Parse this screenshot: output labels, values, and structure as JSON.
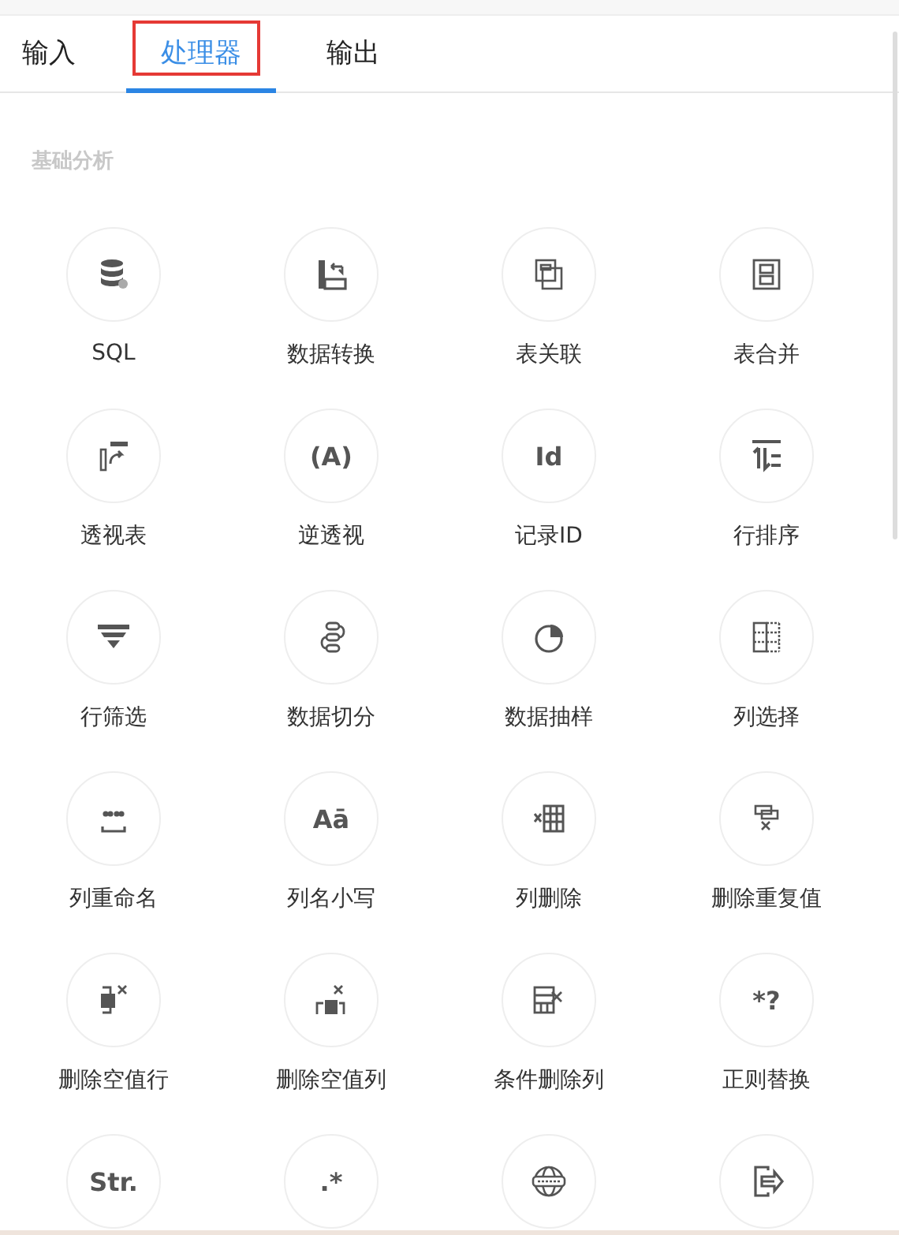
{
  "tabs": [
    {
      "label": "输入",
      "selected": false,
      "highlighted": false
    },
    {
      "label": "处理器",
      "selected": true,
      "highlighted": true
    },
    {
      "label": "输出",
      "selected": false,
      "highlighted": false
    }
  ],
  "section": {
    "title": "基础分析"
  },
  "tools": [
    {
      "label": "SQL",
      "kind": "icon"
    },
    {
      "label": "数据转换",
      "kind": "icon"
    },
    {
      "label": "表关联",
      "kind": "icon"
    },
    {
      "label": "表合并",
      "kind": "icon"
    },
    {
      "label": "透视表",
      "kind": "icon"
    },
    {
      "label": "逆透视",
      "kind": "glyph",
      "glyph": "(A)"
    },
    {
      "label": "记录ID",
      "kind": "glyph",
      "glyph": "Id"
    },
    {
      "label": "行排序",
      "kind": "icon"
    },
    {
      "label": "行筛选",
      "kind": "icon"
    },
    {
      "label": "数据切分",
      "kind": "icon"
    },
    {
      "label": "数据抽样",
      "kind": "icon"
    },
    {
      "label": "列选择",
      "kind": "icon"
    },
    {
      "label": "列重命名",
      "kind": "icon"
    },
    {
      "label": "列名小写",
      "kind": "glyph",
      "glyph": "Aā"
    },
    {
      "label": "列删除",
      "kind": "icon"
    },
    {
      "label": "删除重复值",
      "kind": "icon"
    },
    {
      "label": "删除空值行",
      "kind": "icon"
    },
    {
      "label": "删除空值列",
      "kind": "icon"
    },
    {
      "label": "条件删除列",
      "kind": "icon"
    },
    {
      "label": "正则替换",
      "kind": "glyph",
      "glyph": "*?"
    },
    {
      "kind": "glyph",
      "glyph": "Str."
    },
    {
      "kind": "glyph",
      "glyph": ".*"
    },
    {
      "kind": "icon"
    },
    {
      "kind": "icon"
    }
  ]
}
